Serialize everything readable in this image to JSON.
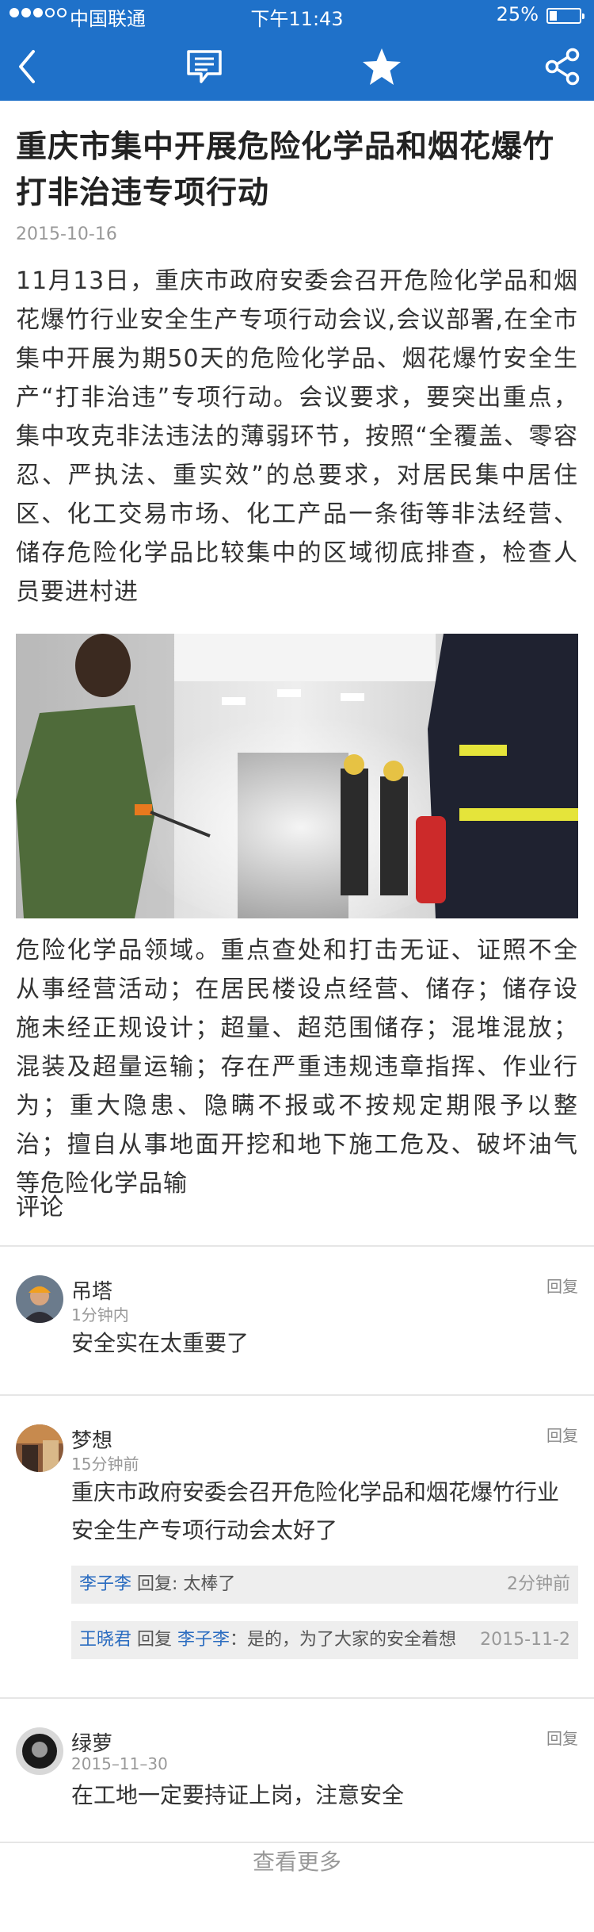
{
  "status_bar": {
    "carrier": "中国联通",
    "time": "下午11:43",
    "battery": "25%",
    "battery_level": 0.25
  },
  "nav": {
    "back_icon": "chevron-left-icon",
    "comment_icon": "comment-icon",
    "star_icon": "star-icon",
    "share_icon": "share-icon",
    "bar_color": "#1f71c9"
  },
  "article": {
    "title": "重庆市集中开展危险化学品和烟花爆竹打非治违专项行动",
    "date": "2015-10-16",
    "para1": "11月13日，重庆市政府安委会召开危险化学品和烟花爆竹行业安全生产专项行动会议,会议部署,在全市集中开展为期50天的危险化学品、烟花爆竹安全生产“打非治违”专项行动。会议要求，要突出重点，集中攻克非法违法的薄弱环节，按照“全覆盖、零容忍、严执法、重实效”的总要求，对居民集中居住区、化工交易市场、化工产品一条街等非法经营、储存危险化学品比较集中的区域彻底排查，检查人员要进村进",
    "para2": "危险化学品领域。重点查处和打击无证、证照不全从事经营活动；在居民楼设点经营、储存；储存设施未经正规设计；超量、超范围储存；混堆混放；混装及超量运输；存在严重违规违章指挥、作业行为；重大隐患、隐瞒不报或不按规定期限予以整治；擅自从事地面开挖和地下施工危及、破坏油气等危险化学品输"
  },
  "comments": {
    "header": "评论",
    "items": [
      {
        "name": "吊塔",
        "time": "1分钟内",
        "reply": "回复",
        "text": "安全实在太重要了"
      },
      {
        "name": "梦想",
        "time": "15分钟前",
        "reply": "回复",
        "text": "重庆市政府安委会召开危险化学品和烟花爆竹行业安全生产专项行动会太好了",
        "subs": [
          {
            "user": "李子李",
            "reply_word": "回复",
            "content": ": 太棒了",
            "time": "2分钟前"
          },
          {
            "user": "王晓君",
            "reply_word": "回复",
            "target": "李子李",
            "content": "：是的，为了大家的安全着想",
            "time": "2015-11-2"
          }
        ]
      },
      {
        "name": "绿萝",
        "time": "2015–11–30",
        "reply": "回复",
        "text": "在工地一定要持证上岗，注意安全"
      }
    ],
    "more": "查看更多"
  }
}
